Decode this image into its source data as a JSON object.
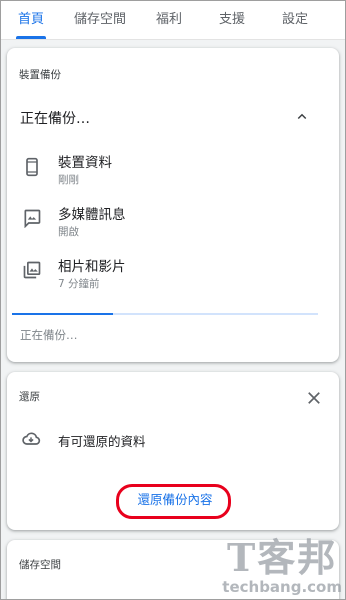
{
  "tabs": [
    {
      "label": "首頁",
      "active": true
    },
    {
      "label": "儲存空間",
      "active": false
    },
    {
      "label": "福利",
      "active": false
    },
    {
      "label": "支援",
      "active": false
    },
    {
      "label": "設定",
      "active": false
    }
  ],
  "backup_card": {
    "section_title": "裝置備份",
    "status_title": "正在備份…",
    "items": [
      {
        "title": "裝置資料",
        "subtitle": "剛剛",
        "icon": "phone-icon"
      },
      {
        "title": "多媒體訊息",
        "subtitle": "開啟",
        "icon": "mms-icon"
      },
      {
        "title": "相片和影片",
        "subtitle": "7 分鐘前",
        "icon": "photos-icon"
      }
    ],
    "progress": 0.33,
    "footer_status": "正在備份…"
  },
  "restore_card": {
    "section_title": "還原",
    "message": "有可還原的資料",
    "button_label": "還原備份內容"
  },
  "storage_card": {
    "section_title": "儲存空間"
  },
  "watermark": {
    "logo_text": "T客邦",
    "domain_text": "techbang.com"
  },
  "colors": {
    "accent": "#1a73e8",
    "highlight": "#e8001c"
  }
}
